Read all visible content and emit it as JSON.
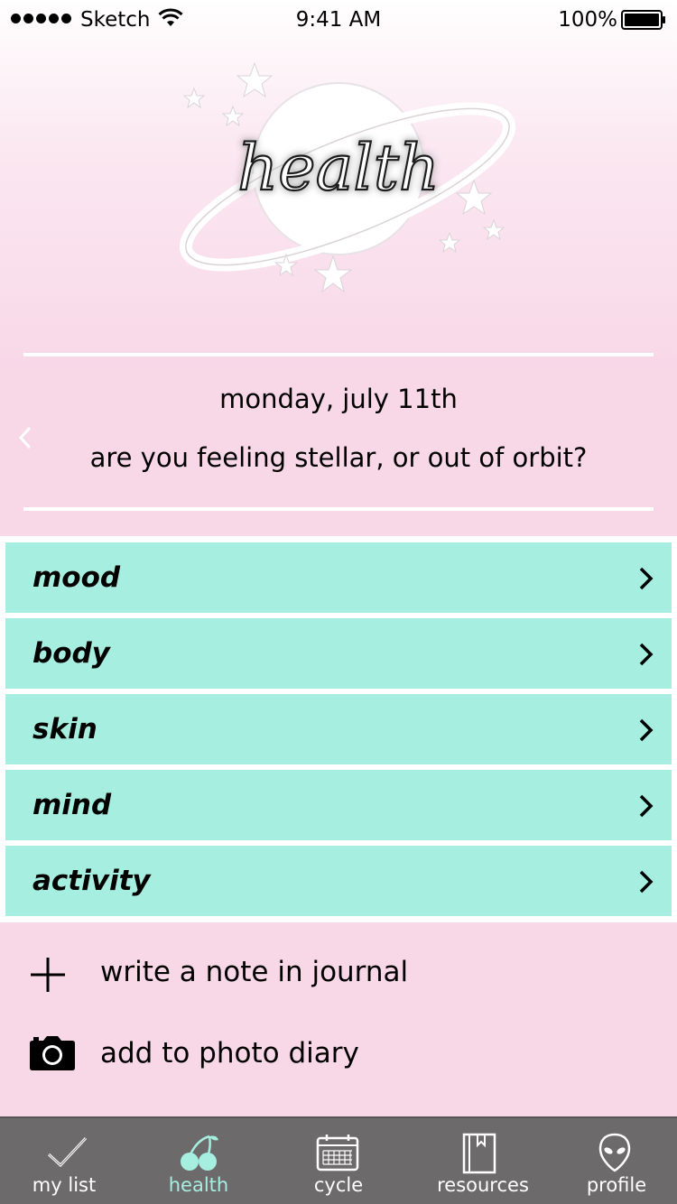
{
  "status_bar": {
    "carrier": "Sketch",
    "time": "9:41 AM",
    "battery": "100%"
  },
  "header": {
    "logo_text": "health",
    "date": "monday, july 11th",
    "question": "are you feeling stellar, or out of orbit?"
  },
  "categories": [
    {
      "label": "mood"
    },
    {
      "label": "body"
    },
    {
      "label": "skin"
    },
    {
      "label": "mind"
    },
    {
      "label": "activity"
    }
  ],
  "actions": {
    "journal": "write a note in journal",
    "photo": "add to photo diary"
  },
  "tabs": [
    {
      "label": "my list",
      "icon": "checkmark-icon"
    },
    {
      "label": "health",
      "icon": "cherries-icon",
      "active": true
    },
    {
      "label": "cycle",
      "icon": "calendar-icon"
    },
    {
      "label": "resources",
      "icon": "book-icon"
    },
    {
      "label": "profile",
      "icon": "alien-icon"
    }
  ],
  "colors": {
    "accent": "#a6eedf",
    "background": "#f8d7e7",
    "tab_bar": "#6d6a6b"
  }
}
